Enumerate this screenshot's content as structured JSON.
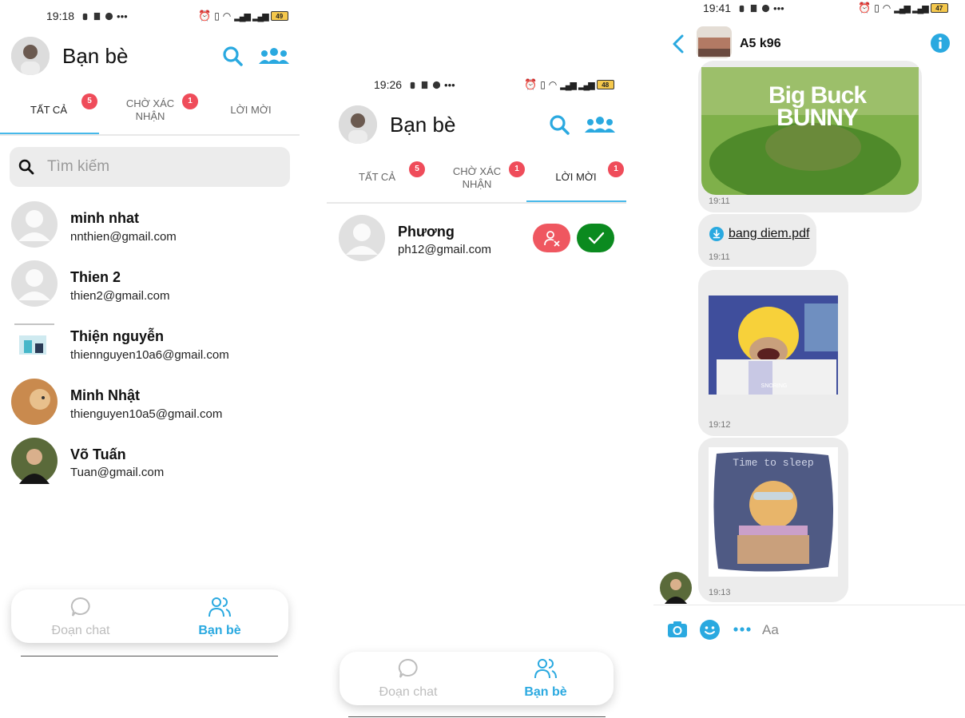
{
  "screen1": {
    "status": {
      "time": "19:18",
      "battery": "49"
    },
    "header": {
      "title": "Bạn bè"
    },
    "tabs": [
      {
        "label_line1": "TẤT CẢ",
        "label_line2": "",
        "badge": "5"
      },
      {
        "label_line1": "CHỜ XÁC",
        "label_line2": "NHẬN",
        "badge": "1"
      },
      {
        "label_line1": "LỜI MỜI",
        "label_line2": "",
        "badge": ""
      }
    ],
    "search": {
      "placeholder": "Tìm kiếm"
    },
    "friends": [
      {
        "name": "minh nhat",
        "email": "nnthien@gmail.com"
      },
      {
        "name": "Thien 2",
        "email": "thien2@gmail.com"
      },
      {
        "name": "Thiện nguyễn",
        "email": "thiennguyen10a6@gmail.com"
      },
      {
        "name": "Minh Nhật",
        "email": "thienguyen10a5@gmail.com"
      },
      {
        "name": "Võ Tuấn",
        "email": "Tuan@gmail.com"
      }
    ],
    "nav": {
      "chat": "Đoạn chat",
      "friends": "Bạn bè"
    }
  },
  "screen2": {
    "status": {
      "time": "19:26",
      "battery": "48"
    },
    "header": {
      "title": "Bạn bè"
    },
    "tabs": [
      {
        "label_line1": "TẤT CẢ",
        "label_line2": "",
        "badge": "5"
      },
      {
        "label_line1": "CHỜ XÁC",
        "label_line2": "NHẬN",
        "badge": "1"
      },
      {
        "label_line1": "LỜI MỜI",
        "label_line2": "",
        "badge": "1"
      }
    ],
    "request": {
      "name": "Phương",
      "email": "ph12@gmail.com"
    },
    "nav": {
      "chat": "Đoạn chat",
      "friends": "Bạn bè"
    }
  },
  "screen3": {
    "status": {
      "time": "19:41",
      "battery": "47"
    },
    "header": {
      "title": "A5 k96"
    },
    "video_title": "Big Buck BUNNY",
    "image_caption": "SNORING",
    "sticker_text": "Time to sleep",
    "messages": [
      {
        "type": "video",
        "time": "19:11"
      },
      {
        "type": "file",
        "file_name": "bang diem.pdf",
        "time": "19:11"
      },
      {
        "type": "image",
        "time": "19:12"
      },
      {
        "type": "sticker",
        "time": "19:13"
      }
    ],
    "composer": {
      "placeholder": "Aa"
    }
  },
  "colors": {
    "accent": "#2aa9e0",
    "badge": "#ef4c5a",
    "decline": "#ef5760",
    "accept": "#0b8a1f",
    "underline": "#47b9ea"
  }
}
